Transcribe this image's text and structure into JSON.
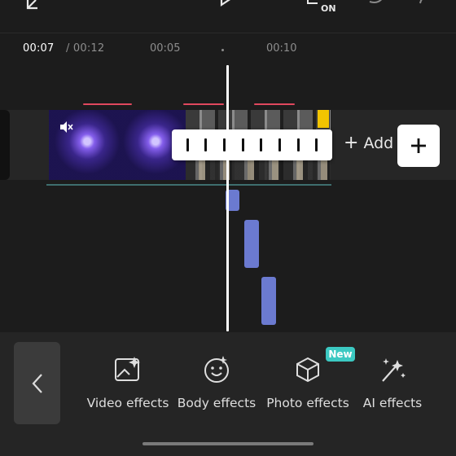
{
  "timeline": {
    "current_time": "00:07",
    "total_time": "/ 00:12",
    "ticks": [
      "00:05",
      "00:10"
    ]
  },
  "track": {
    "add_label": "Add"
  },
  "tools": [
    {
      "label": "Video effects",
      "icon": "video-effects-icon"
    },
    {
      "label": "Body effects",
      "icon": "body-effects-icon"
    },
    {
      "label": "Photo effects",
      "icon": "photo-effects-icon",
      "badge": "New"
    },
    {
      "label": "AI effects",
      "icon": "ai-effects-icon"
    }
  ],
  "top_bar": {
    "record_badge": "ON"
  },
  "colors": {
    "accent": "#6b7ad0",
    "badge": "#3cc9c2",
    "clip_marker": "#e0485e"
  }
}
